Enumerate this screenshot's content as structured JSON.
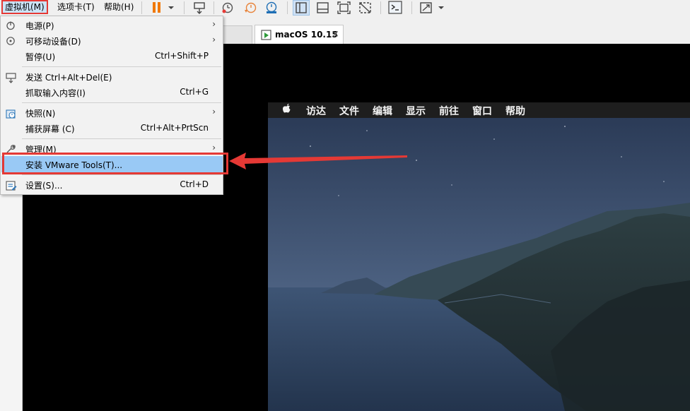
{
  "menubar": {
    "vm": "虚拟机(M)",
    "tabs": "选项卡(T)",
    "help": "帮助(H)"
  },
  "tab": {
    "title": "macOS 10.15",
    "close": "×"
  },
  "guest_menubar": {
    "items": [
      "访达",
      "文件",
      "编辑",
      "显示",
      "前往",
      "窗口",
      "帮助"
    ]
  },
  "menu": {
    "power": {
      "label": "电源(P)",
      "icon": "power-icon"
    },
    "removable": {
      "label": "可移动设备(D)",
      "icon": "device-icon"
    },
    "pause": {
      "label": "暂停(U)",
      "shortcut": "Ctrl+Shift+P"
    },
    "send_cad": {
      "label": "发送 Ctrl+Alt+Del(E)",
      "icon": "keyboard-icon"
    },
    "grab_input": {
      "label": "抓取输入内容(I)",
      "shortcut": "Ctrl+G"
    },
    "snapshot": {
      "label": "快照(N)",
      "icon": "snapshot-icon"
    },
    "capture": {
      "label": "捕获屏幕 (C)",
      "shortcut": "Ctrl+Alt+PrtScn"
    },
    "manage": {
      "label": "管理(M)",
      "icon": "wrench-icon"
    },
    "install_tools": {
      "label": "安装 VMware Tools(T)..."
    },
    "settings": {
      "label": "设置(S)...",
      "shortcut": "Ctrl+D",
      "icon": "settings-icon"
    }
  },
  "colors": {
    "highlight": "#99c9f5",
    "annotation_red": "#e53935",
    "pause_orange": "#f0790a"
  }
}
